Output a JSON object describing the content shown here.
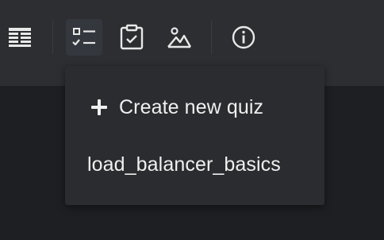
{
  "toolbar": {
    "buttons": [
      {
        "icon": "table-icon"
      },
      {
        "icon": "checklist-icon",
        "active": true
      },
      {
        "icon": "clipboard-check-icon"
      },
      {
        "icon": "landscape-icon"
      },
      {
        "icon": "info-icon"
      }
    ]
  },
  "dropdown": {
    "create_label": "Create new quiz",
    "items": [
      {
        "label": "load_balancer_basics"
      }
    ]
  },
  "colors": {
    "toolbar_bg": "#2d2e31",
    "page_bg": "#1e1f22",
    "menu_bg": "#2b2c2f",
    "text": "#f0f0f0",
    "active_bg": "#34373d"
  }
}
